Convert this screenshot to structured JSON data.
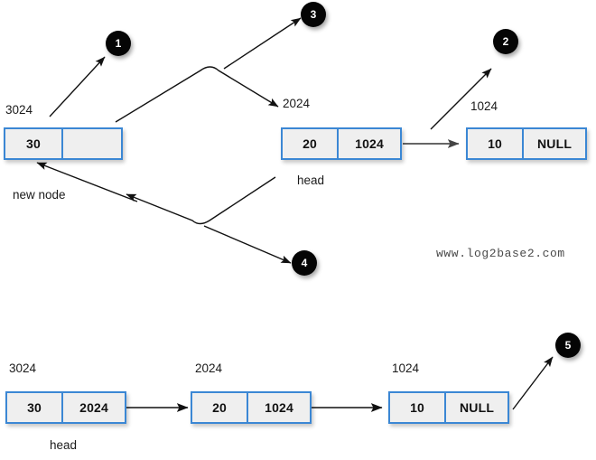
{
  "diagram": {
    "watermark": "www.log2base2.com",
    "top_row": {
      "new_node": {
        "address": "3024",
        "data": "30",
        "next": "",
        "caption": "new node"
      },
      "node_2024": {
        "address": "2024",
        "data": "20",
        "next": "1024",
        "caption": "head"
      },
      "node_1024": {
        "address": "1024",
        "data": "10",
        "next": "NULL"
      }
    },
    "bottom_row": {
      "node_3024": {
        "address": "3024",
        "data": "30",
        "next": "2024",
        "caption": "head"
      },
      "node_2024": {
        "address": "2024",
        "data": "20",
        "next": "1024"
      },
      "node_1024": {
        "address": "1024",
        "data": "10",
        "next": "NULL"
      }
    },
    "steps": [
      {
        "id": "1",
        "label": "1"
      },
      {
        "id": "2",
        "label": "2"
      },
      {
        "id": "3",
        "label": "3"
      },
      {
        "id": "4",
        "label": "4"
      },
      {
        "id": "5",
        "label": "5"
      }
    ]
  }
}
